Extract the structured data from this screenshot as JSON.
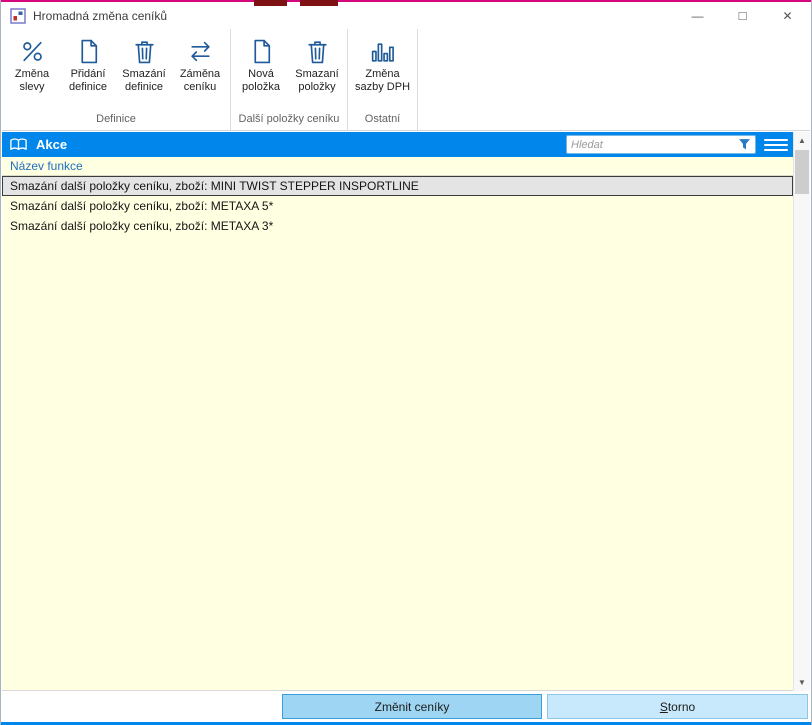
{
  "window": {
    "title": "Hromadná změna ceníků",
    "minimize": "—",
    "maximize": "□",
    "close": "✕"
  },
  "ribbon": {
    "groups": [
      {
        "label": "Definice",
        "buttons": [
          {
            "line1": "Změna",
            "line2": "slevy",
            "icon": "discount-icon"
          },
          {
            "line1": "Přidání",
            "line2": "definice",
            "icon": "new-document-icon"
          },
          {
            "line1": "Smazání",
            "line2": "definice",
            "icon": "trash-icon"
          },
          {
            "line1": "Záměna",
            "line2": "ceníku",
            "icon": "swap-arrows-icon"
          }
        ]
      },
      {
        "label": "Další položky ceníku",
        "buttons": [
          {
            "line1": "Nová",
            "line2": "položka",
            "icon": "new-document-icon"
          },
          {
            "line1": "Smazaní",
            "line2": "položky",
            "icon": "trash-icon"
          }
        ]
      },
      {
        "label": "Ostatní",
        "buttons": [
          {
            "line1": "Změna",
            "line2": "sazby DPH",
            "icon": "bar-chart-icon"
          }
        ]
      }
    ]
  },
  "panel": {
    "title": "Akce",
    "search_placeholder": "Hledat",
    "column_header": "Název funkce",
    "rows": [
      "Smazání další položky ceníku, zboží: MINI TWIST STEPPER INSPORTLINE",
      "Smazání další položky ceníku, zboží: METAXA 5*",
      "Smazání další položky ceníku, zboží: METAXA 3*"
    ]
  },
  "footer": {
    "primary": "Změnit ceníky",
    "storno_key": "S",
    "storno_rest": "torno"
  },
  "colors": {
    "accent_blue": "#0187ec",
    "icon_blue": "#1f5b99",
    "list_bg": "#ffffe1",
    "selected_row_bg": "#e4e4e4",
    "header_text_blue": "#1f6fc0",
    "primary_button_bg": "#9ed5f2",
    "secondary_button_bg": "#c8e9fb",
    "top_edge": "#d6087f"
  }
}
